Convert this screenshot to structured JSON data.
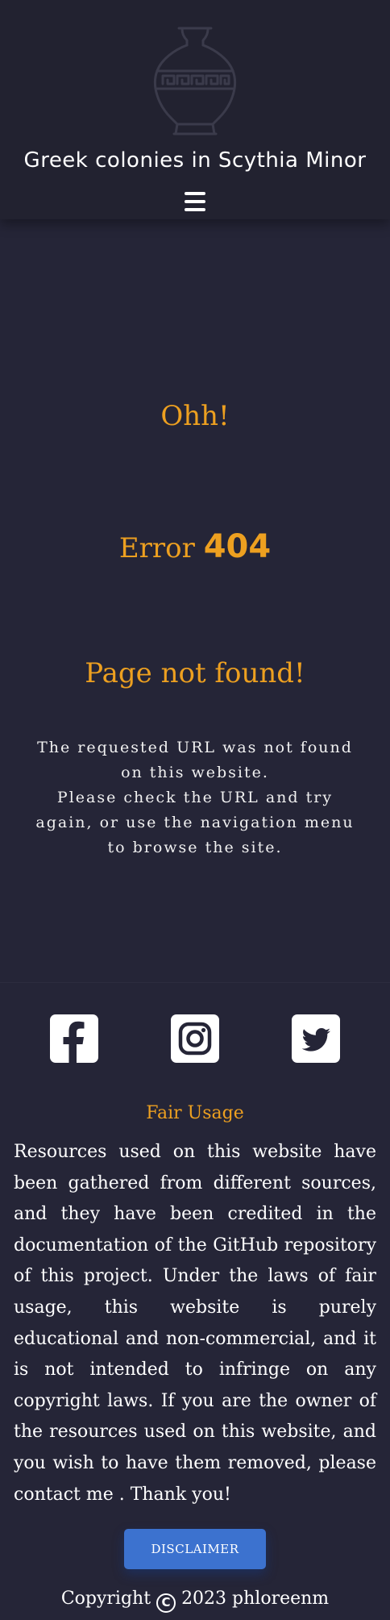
{
  "header": {
    "title": "Greek colonies in Scythia Minor",
    "logo_icon": "greek-vase-icon",
    "menu_icon": "hamburger-menu-icon"
  },
  "main": {
    "exclamation": "Ohh!",
    "error_prefix": "Error",
    "error_code": "404",
    "not_found": "Page not found!",
    "message_lines": [
      "The requested URL was not found on this website.",
      "Please check the URL and try again, or use the navigation menu to browse the site."
    ]
  },
  "footer": {
    "social": [
      {
        "name": "Facebook",
        "icon": "facebook-icon"
      },
      {
        "name": "Instagram",
        "icon": "instagram-icon"
      },
      {
        "name": "Twitter",
        "icon": "twitter-icon"
      }
    ],
    "fair_usage_title": "Fair Usage",
    "fair_usage_text": "Resources used on this website have been gathered from different sources, and they have been credited in the documentation of the GitHub repository of this project. Under the laws of fair usage, this website is purely educational and non-commercial, and it is not intended to infringe on any copyright laws. If you are the owner of the resources used on this website, and you wish to have them removed, please contact me . Thank you!",
    "disclaimer_label": "DISCLAIMER",
    "copyright_symbol": "C",
    "copyright_text": "2023 phloreenm"
  },
  "colors": {
    "page_background": "#252537",
    "header_background": "#222230",
    "accent_orange": "#eda020",
    "button_blue": "#3c72cf",
    "text_white": "#ffffff"
  }
}
